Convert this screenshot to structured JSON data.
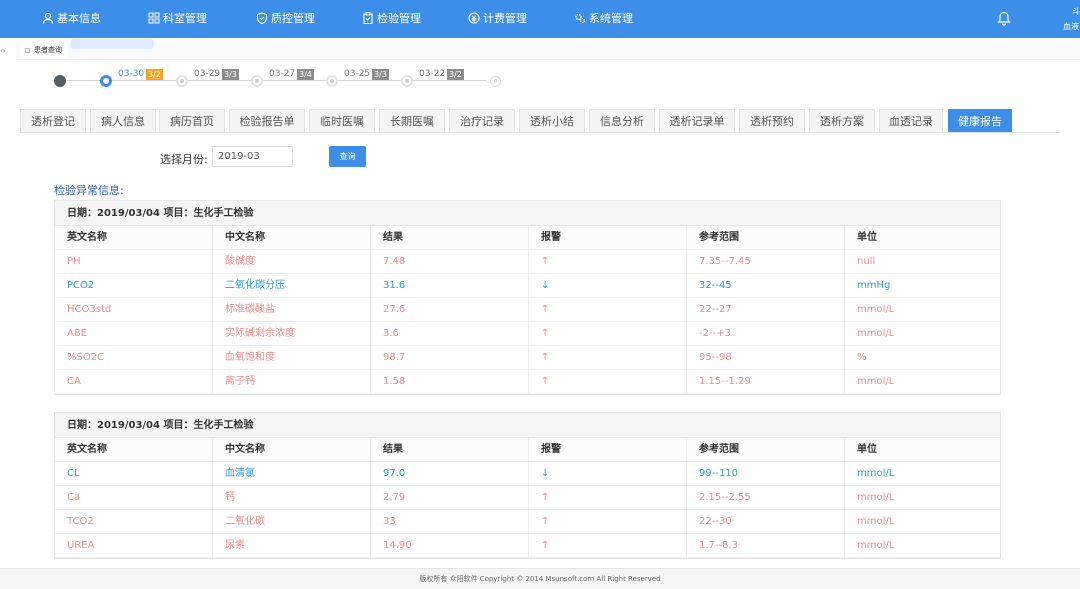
{
  "nav": {
    "items": [
      {
        "label": "基本信息",
        "icon": "user-icon"
      },
      {
        "label": "科室管理",
        "icon": "grid-icon"
      },
      {
        "label": "质控管理",
        "icon": "shield-icon"
      },
      {
        "label": "检验管理",
        "icon": "clipboard-icon"
      },
      {
        "label": "计费管理",
        "icon": "currency-icon"
      },
      {
        "label": "系统管理",
        "icon": "gear-icon"
      }
    ],
    "bell_icon": "bell-icon",
    "user_top": "斗",
    "user_bottom": "血液"
  },
  "breadcrumb": {
    "tab_label": "患者查询",
    "side_marker": "‹›"
  },
  "timeline": {
    "points": [
      {
        "date": "03-30",
        "count": "3/2",
        "active": true
      },
      {
        "date": "03-29",
        "count": "3/3",
        "active": false
      },
      {
        "date": "03-27",
        "count": "3/4",
        "active": false
      },
      {
        "date": "03-25",
        "count": "3/3",
        "active": false
      },
      {
        "date": "03-22",
        "count": "3/2",
        "active": false
      }
    ],
    "next_icon": "»"
  },
  "tabs": [
    "透析登记",
    "病人信息",
    "病历首页",
    "检验报告单",
    "临时医嘱",
    "长期医嘱",
    "治疗记录",
    "透析小结",
    "信息分析",
    "透析记录单",
    "透析预约",
    "透析方案",
    "血透记录",
    "健康报告"
  ],
  "active_tab": "健康报告",
  "filter": {
    "label": "选择月份:",
    "value": "2019-03",
    "button": "查询"
  },
  "section_title": "检验异常信息:",
  "columns": [
    "英文名称",
    "中文名称",
    "结果",
    "报警",
    "参考范围",
    "单位"
  ],
  "tables": [
    {
      "caption": "日期：2019/03/04 项目：生化手工检验",
      "rows": [
        {
          "en": "PH",
          "cn": "酸碱度",
          "result": "7.48",
          "alarm": "↑",
          "range": "7.35--7.45",
          "unit": "null",
          "status": "high"
        },
        {
          "en": "PCO2",
          "cn": "二氧化碳分压",
          "result": "31.6",
          "alarm": "↓",
          "range": "32--45",
          "unit": "mmHg",
          "status": "low"
        },
        {
          "en": "HCO3std",
          "cn": "标准碳酸盐",
          "result": "27.6",
          "alarm": "↑",
          "range": "22--27",
          "unit": "mmol/L",
          "status": "high"
        },
        {
          "en": "ABE",
          "cn": "实际碱剩余浓度",
          "result": "3.6",
          "alarm": "↑",
          "range": "-2--+3",
          "unit": "mmol/L",
          "status": "high"
        },
        {
          "en": "%SO2C",
          "cn": "血氧饱和度",
          "result": "98.7",
          "alarm": "↑",
          "range": "95--98",
          "unit": "%",
          "status": "high"
        },
        {
          "en": "CA",
          "cn": "离子钙",
          "result": "1.58",
          "alarm": "↑",
          "range": "1.15--1.29",
          "unit": "mmol/L",
          "status": "high"
        }
      ]
    },
    {
      "caption": "日期：2019/03/04 项目：生化手工检验",
      "rows": [
        {
          "en": "CL",
          "cn": "血清氯",
          "result": "97.0",
          "alarm": "↓",
          "range": "99--110",
          "unit": "mmol/L",
          "status": "low"
        },
        {
          "en": "Ca",
          "cn": "钙",
          "result": "2.79",
          "alarm": "↑",
          "range": "2.15--2.55",
          "unit": "mmol/L",
          "status": "high"
        },
        {
          "en": "TCO2",
          "cn": "二氧化碳",
          "result": "33",
          "alarm": "↑",
          "range": "22--30",
          "unit": "mmol/L",
          "status": "high"
        },
        {
          "en": "UREA",
          "cn": "尿素",
          "result": "14.90",
          "alarm": "↑",
          "range": "1.7--8.3",
          "unit": "mmol/L",
          "status": "high"
        }
      ]
    }
  ],
  "footer": "版权所有 众阳软件 Copyright © 2014 Msunsoft.com All Right Reserved",
  "colors": {
    "primary": "#3d8ee8",
    "high": "#f08b8b",
    "low": "#2d9ce0",
    "badge_active": "#f5a623"
  }
}
